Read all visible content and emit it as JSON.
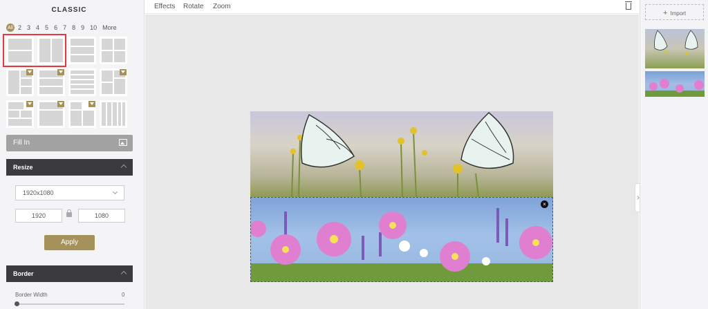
{
  "left_panel": {
    "title": "CLASSIC",
    "filters": [
      "All",
      "2",
      "3",
      "4",
      "5",
      "6",
      "7",
      "8",
      "9",
      "10",
      "More"
    ],
    "fill_in_label": "Fill In",
    "resize": {
      "header": "Resize",
      "size_select": "1920x1080",
      "width": "1920",
      "height": "1080",
      "apply_label": "Apply"
    },
    "border": {
      "header": "Border",
      "width_label": "Border Width",
      "width_value": "0"
    }
  },
  "toolbar": {
    "effects": "Effects",
    "rotate": "Rotate",
    "zoom": "Zoom"
  },
  "right_panel": {
    "import_label": "Import"
  },
  "colors": {
    "accent_gold": "#a5925a",
    "dark_header": "#3b3b3f",
    "selection_red": "#e0393f"
  }
}
